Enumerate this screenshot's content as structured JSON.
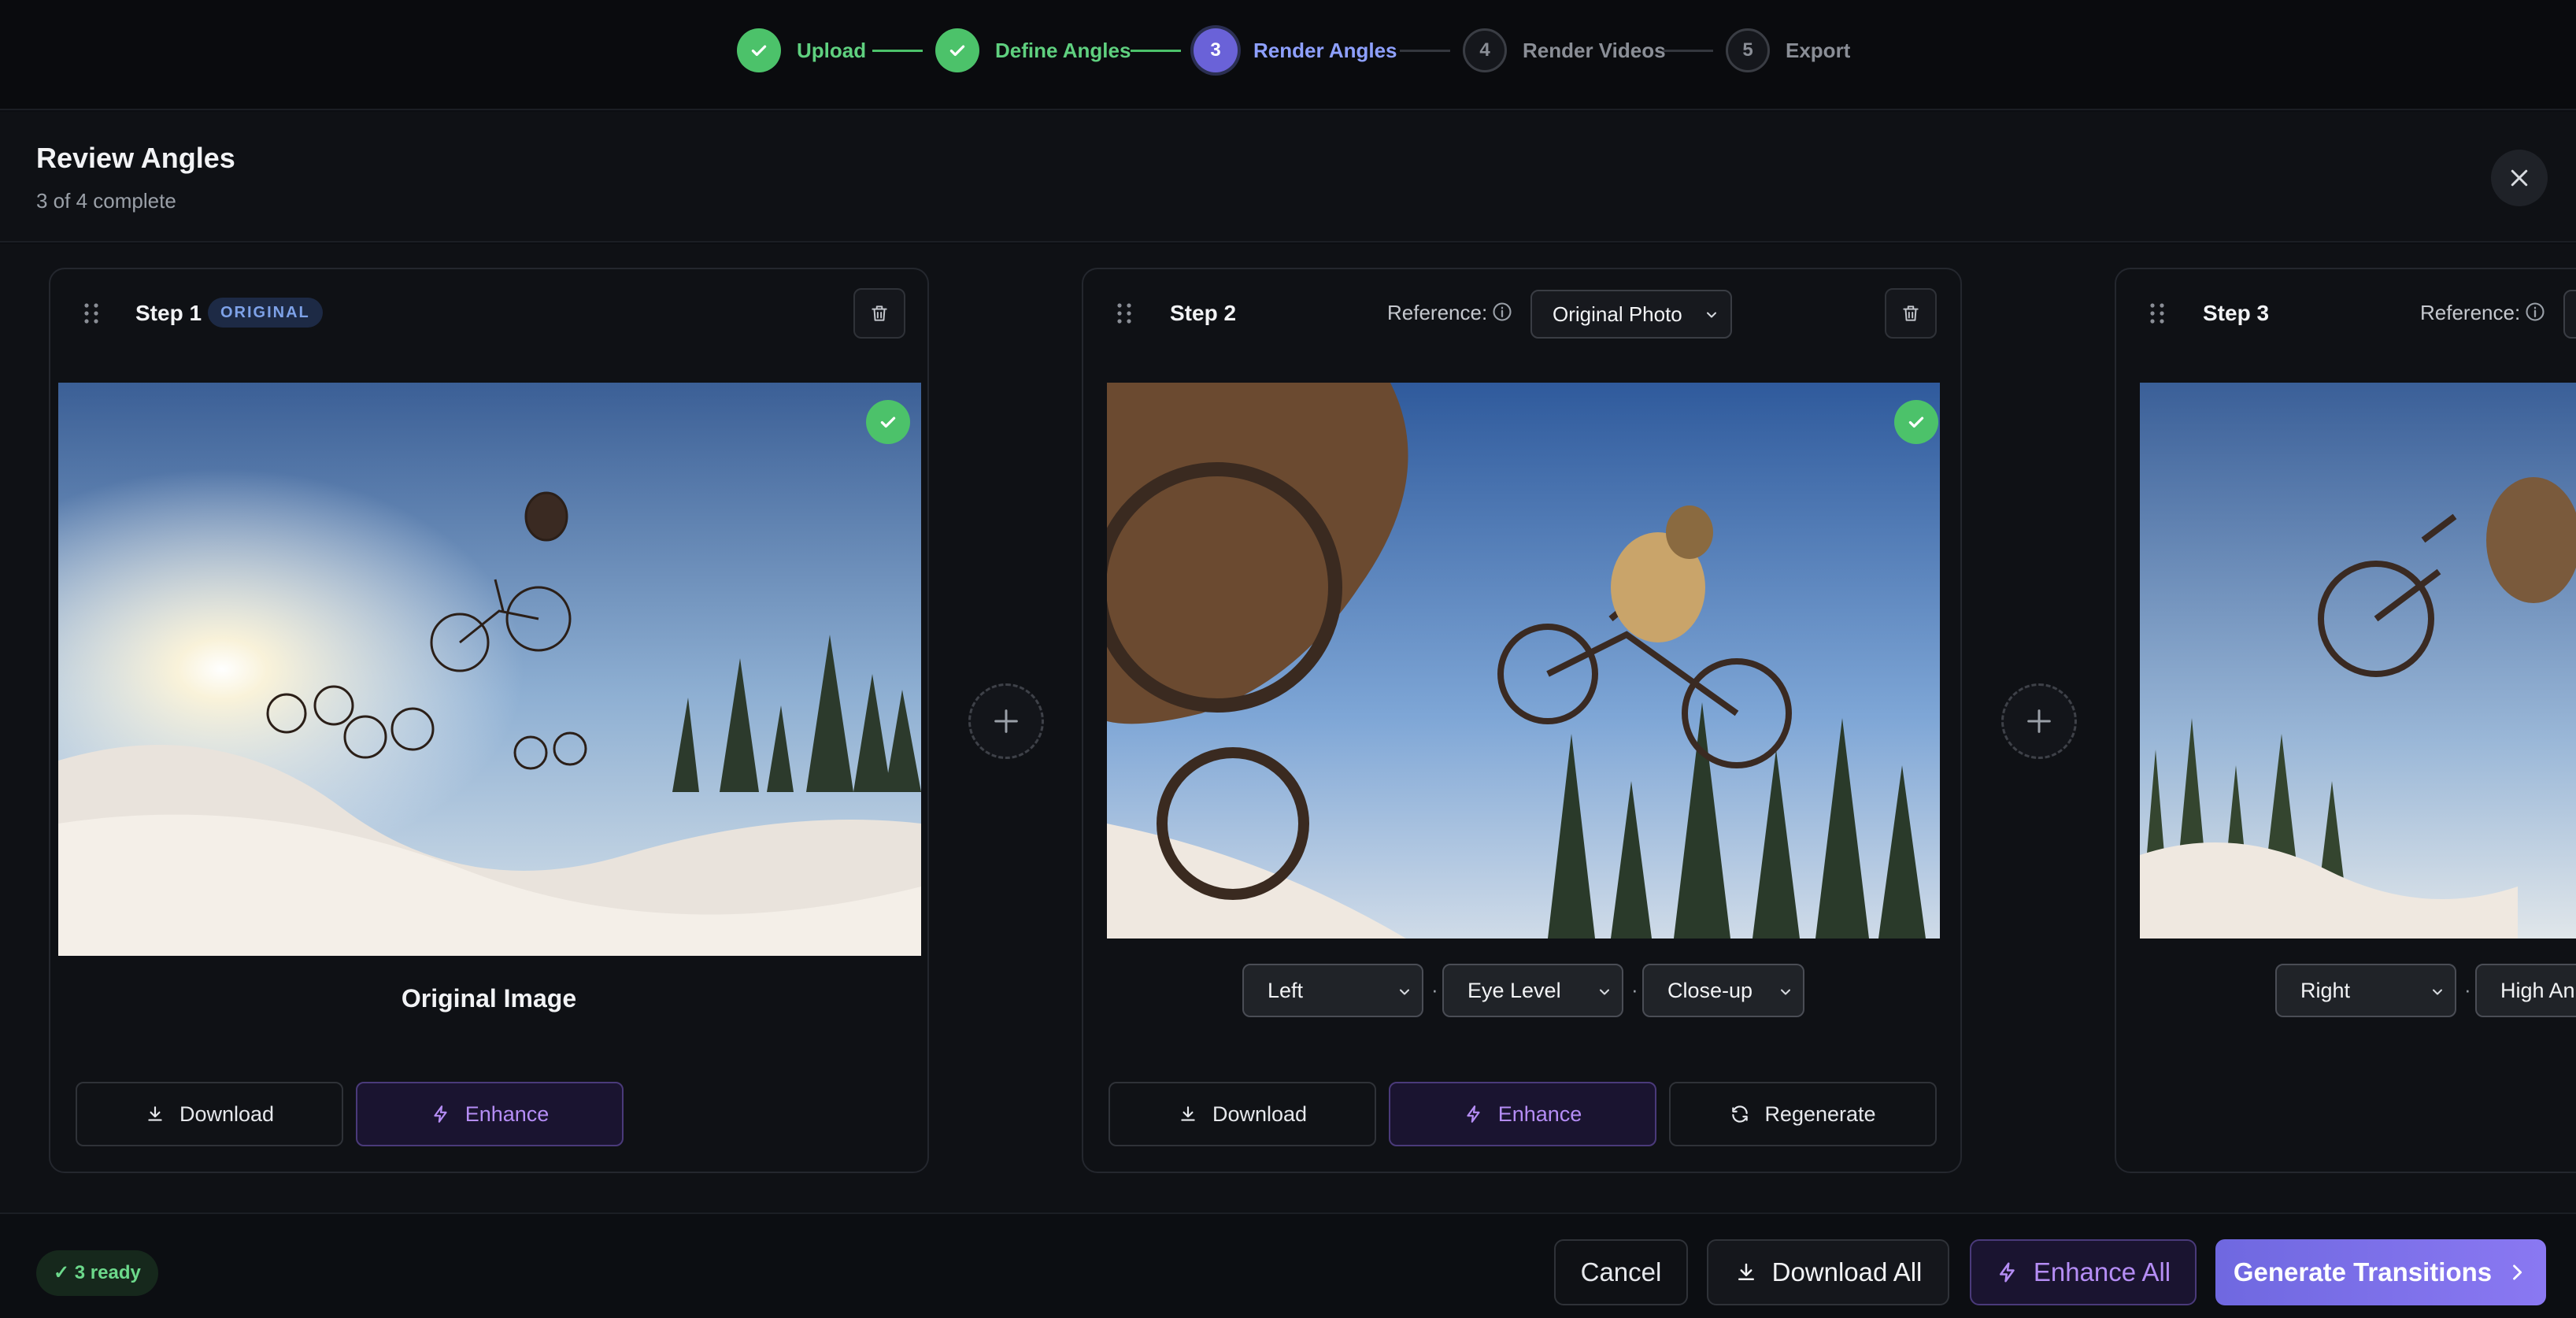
{
  "stepper": {
    "steps": [
      {
        "label": "Upload",
        "status": "done",
        "number": ""
      },
      {
        "label": "Define Angles",
        "status": "done",
        "number": ""
      },
      {
        "label": "Render Angles",
        "status": "active",
        "number": "3"
      },
      {
        "label": "Render Videos",
        "status": "pending",
        "number": "4"
      },
      {
        "label": "Export",
        "status": "pending",
        "number": "5"
      }
    ]
  },
  "header": {
    "title": "Review Angles",
    "subtitle": "3 of 4 complete"
  },
  "cards": [
    {
      "title": "Step 1",
      "badge": "ORIGINAL",
      "caption": "Original Image",
      "complete": true,
      "actions": {
        "download": "Download",
        "enhance": "Enhance"
      }
    },
    {
      "title": "Step 2",
      "reference_label": "Reference:",
      "reference_value": "Original Photo",
      "complete": true,
      "dropdowns": {
        "direction": "Left",
        "height": "Eye Level",
        "shot": "Close-up"
      },
      "actions": {
        "download": "Download",
        "enhance": "Enhance",
        "regenerate": "Regenerate"
      }
    },
    {
      "title": "Step 3",
      "reference_label": "Reference:",
      "dropdowns": {
        "direction": "Right",
        "height": "High An"
      }
    }
  ],
  "separator": "·",
  "footer": {
    "ready_badge": "3 ready",
    "cancel": "Cancel",
    "download_all": "Download All",
    "enhance_all": "Enhance All",
    "generate": "Generate Transitions"
  },
  "icons": {
    "check": "check-icon",
    "close": "close-icon",
    "trash": "trash-icon",
    "drag": "drag-handle-icon",
    "info": "info-icon",
    "chevron": "chevron-down-icon",
    "download": "download-icon",
    "enhance": "lightning-icon",
    "regenerate": "refresh-icon",
    "add": "plus-icon",
    "next": "chevron-right-icon"
  },
  "colors": {
    "success": "#4cc26a",
    "active_step": "#6a62d8",
    "enhance": "#b58df5",
    "primary_gradient_start": "#6f68e0",
    "primary_gradient_end": "#8a78f2"
  }
}
